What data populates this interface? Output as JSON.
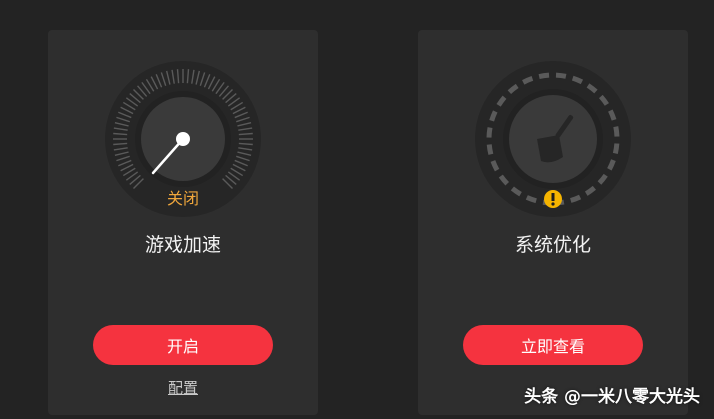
{
  "cards": [
    {
      "id": "game-boost",
      "title": "游戏加速",
      "state": "关闭",
      "button_label": "开启",
      "link_label": "配置",
      "icon": "speed-gauge-icon"
    },
    {
      "id": "system-optimize",
      "title": "系统优化",
      "button_label": "立即查看",
      "icon": "broom-icon",
      "alert_icon": "warning-icon"
    }
  ],
  "watermark": "头条 @一米八零大光头",
  "colors": {
    "background": "#232323",
    "card": "#2e2e2e",
    "accent_button": "#f5333f",
    "state_off": "#f0a73c",
    "warning": "#f5b400"
  }
}
